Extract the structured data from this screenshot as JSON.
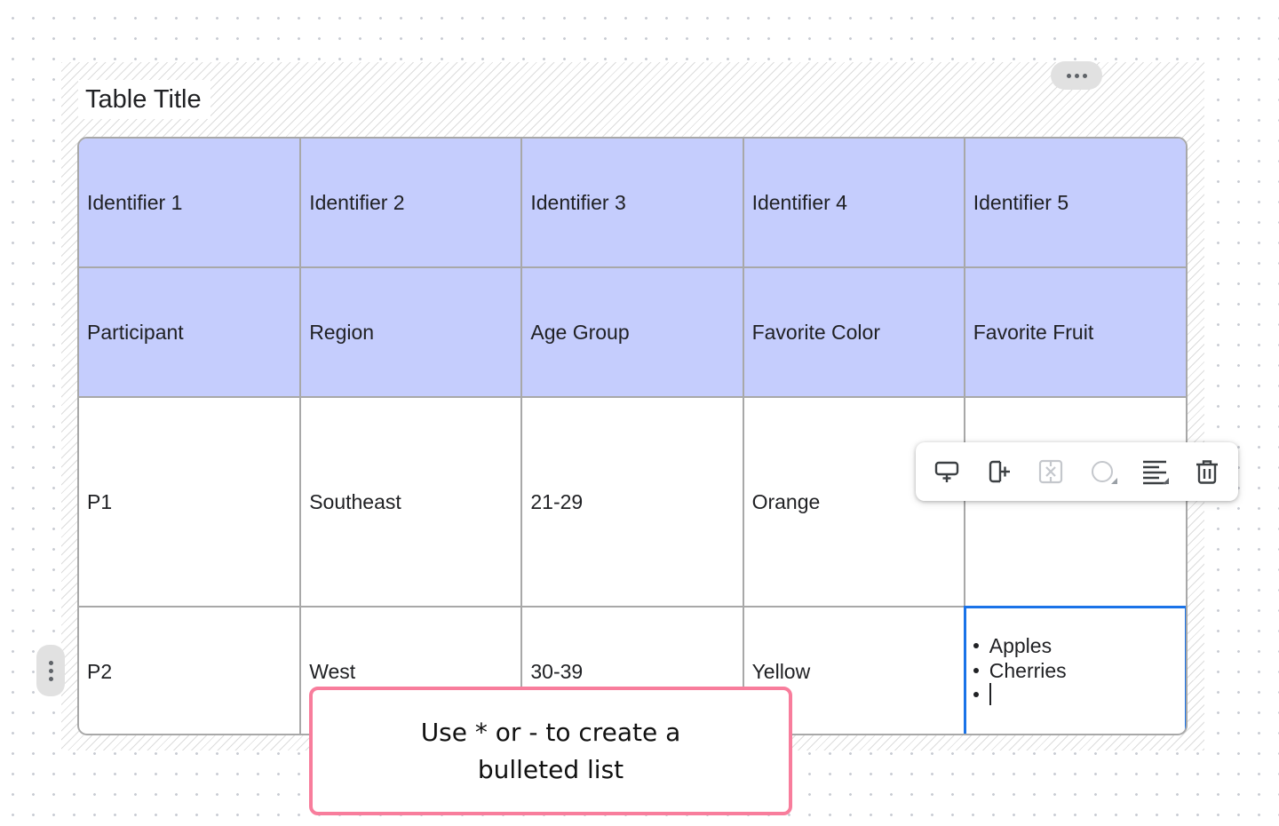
{
  "table": {
    "title": "Table Title",
    "headers": [
      [
        "Identifier 1",
        "Identifier 2",
        "Identifier 3",
        "Identifier 4",
        "Identifier 5"
      ],
      [
        "Participant",
        "Region",
        "Age Group",
        "Favorite Color",
        "Favorite Fruit"
      ]
    ],
    "rows": [
      [
        "P1",
        "Southeast",
        "21-29",
        "Orange",
        ""
      ],
      [
        "P2",
        "West",
        "30-39",
        "Yellow",
        ""
      ]
    ],
    "editing_cell": {
      "bullets": [
        "Apples",
        "Cherries",
        ""
      ]
    }
  },
  "colors": {
    "header_bg": "#c5cdfd",
    "border": "#a8a8a8",
    "editing_border": "#1a73e8",
    "tooltip_border": "#f87d9c"
  },
  "toolbar": {
    "icons": [
      "insert-row-below-icon",
      "insert-column-right-icon",
      "delete-cells-icon",
      "cell-fill-color-icon",
      "text-align-icon",
      "trash-icon"
    ]
  },
  "tooltip": {
    "line1": "Use * or - to create a",
    "line2": "bulleted list"
  }
}
